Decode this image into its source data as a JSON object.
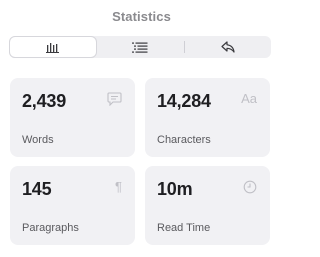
{
  "title": "Statistics",
  "tabs": [
    {
      "name": "bar-chart-icon",
      "active": true
    },
    {
      "name": "list-icon",
      "active": false
    },
    {
      "name": "reply-icon",
      "active": false
    }
  ],
  "stats": {
    "words": {
      "value": "2,439",
      "label": "Words",
      "icon": "comment-icon"
    },
    "characters": {
      "value": "14,284",
      "label": "Characters",
      "icon": "text-size-icon",
      "glyph": "Aa"
    },
    "paragraphs": {
      "value": "145",
      "label": "Paragraphs",
      "icon": "pilcrow-icon",
      "glyph": "¶"
    },
    "read_time": {
      "value": "10m",
      "label": "Read Time",
      "icon": "clock-icon"
    }
  },
  "colors": {
    "card_bg": "#f1f1f4",
    "segment_bg": "#efeff2",
    "title": "#8a8a8e",
    "value": "#1f1f22",
    "label": "#5a5a5e",
    "icon": "#c0c0c6"
  }
}
